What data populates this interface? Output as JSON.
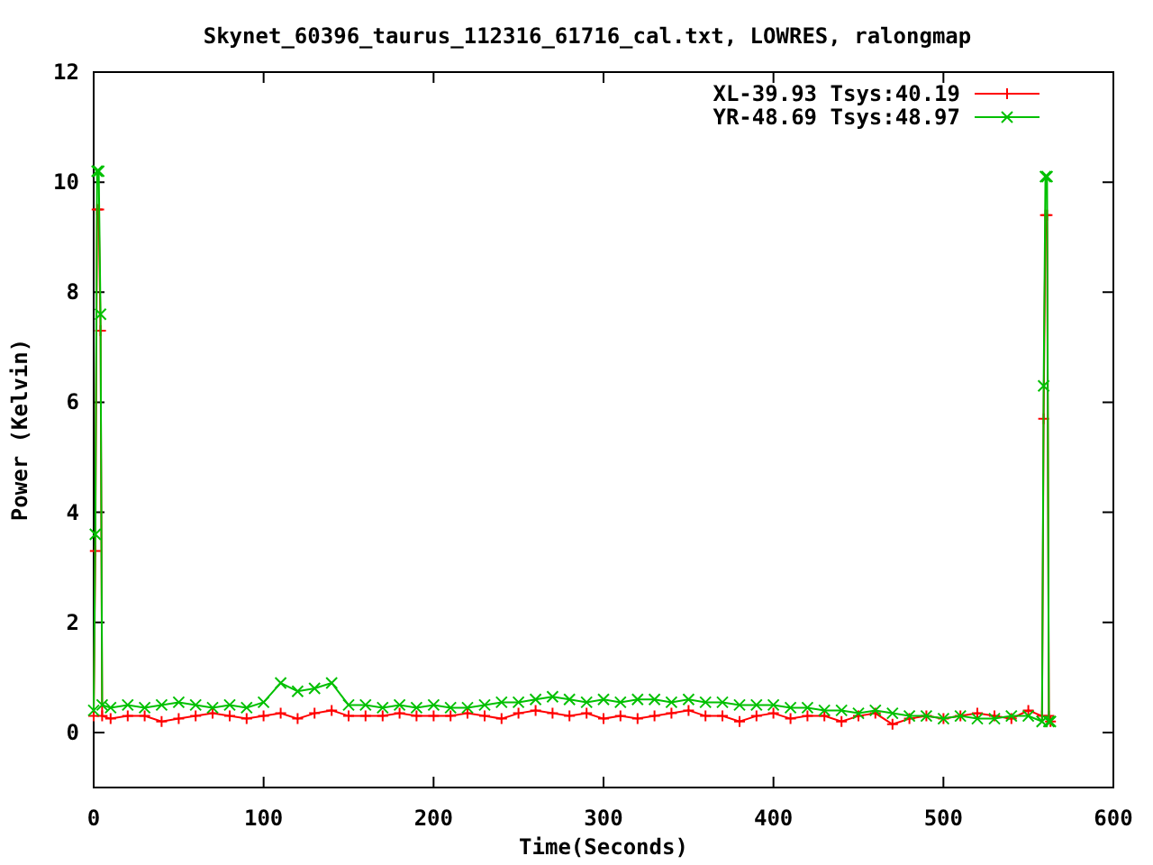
{
  "chart_data": {
    "type": "line",
    "title": "Skynet_60396_taurus_112316_61716_cal.txt, LOWRES, ralongmap",
    "xlabel": "Time(Seconds)",
    "ylabel": "Power (Kelvin)",
    "x": [
      0,
      1,
      2,
      3,
      4,
      5,
      10,
      20,
      30,
      40,
      50,
      60,
      70,
      80,
      90,
      100,
      110,
      120,
      130,
      140,
      150,
      160,
      170,
      180,
      190,
      200,
      210,
      220,
      230,
      240,
      250,
      260,
      270,
      280,
      290,
      300,
      310,
      320,
      330,
      340,
      350,
      360,
      370,
      380,
      390,
      400,
      410,
      420,
      430,
      440,
      450,
      460,
      470,
      480,
      490,
      500,
      510,
      520,
      530,
      540,
      550,
      558,
      559,
      560,
      561,
      562,
      563
    ],
    "series": [
      {
        "name": "XL-39.93 Tsys:40.19",
        "color": "#ff0000",
        "marker": "plus",
        "values": [
          0.3,
          3.3,
          9.5,
          9.5,
          7.3,
          0.3,
          0.25,
          0.3,
          0.3,
          0.2,
          0.25,
          0.3,
          0.35,
          0.3,
          0.25,
          0.3,
          0.35,
          0.25,
          0.35,
          0.4,
          0.3,
          0.3,
          0.3,
          0.35,
          0.3,
          0.3,
          0.3,
          0.35,
          0.3,
          0.25,
          0.35,
          0.4,
          0.35,
          0.3,
          0.35,
          0.25,
          0.3,
          0.25,
          0.3,
          0.35,
          0.4,
          0.3,
          0.3,
          0.2,
          0.3,
          0.35,
          0.25,
          0.3,
          0.3,
          0.2,
          0.3,
          0.35,
          0.15,
          0.25,
          0.3,
          0.25,
          0.3,
          0.35,
          0.3,
          0.25,
          0.4,
          0.3,
          5.7,
          9.4,
          9.4,
          0.3,
          0.2
        ]
      },
      {
        "name": "YR-48.69 Tsys:48.97",
        "color": "#00c000",
        "marker": "cross",
        "values": [
          0.4,
          3.6,
          10.2,
          10.2,
          7.6,
          0.5,
          0.45,
          0.5,
          0.45,
          0.5,
          0.55,
          0.5,
          0.45,
          0.5,
          0.45,
          0.55,
          0.9,
          0.75,
          0.8,
          0.9,
          0.5,
          0.5,
          0.45,
          0.5,
          0.45,
          0.5,
          0.45,
          0.45,
          0.5,
          0.55,
          0.55,
          0.6,
          0.65,
          0.6,
          0.55,
          0.6,
          0.55,
          0.6,
          0.6,
          0.55,
          0.6,
          0.55,
          0.55,
          0.5,
          0.5,
          0.5,
          0.45,
          0.45,
          0.4,
          0.4,
          0.35,
          0.4,
          0.35,
          0.3,
          0.3,
          0.25,
          0.3,
          0.25,
          0.25,
          0.3,
          0.3,
          0.2,
          6.3,
          10.1,
          10.1,
          0.2,
          0.2
        ]
      }
    ],
    "legend": true,
    "xlim": [
      0,
      600
    ],
    "ylim": [
      -1,
      12
    ],
    "xticks": [
      0,
      100,
      200,
      300,
      400,
      500,
      600
    ],
    "yticks": [
      0,
      2,
      4,
      6,
      8,
      10,
      12
    ]
  }
}
